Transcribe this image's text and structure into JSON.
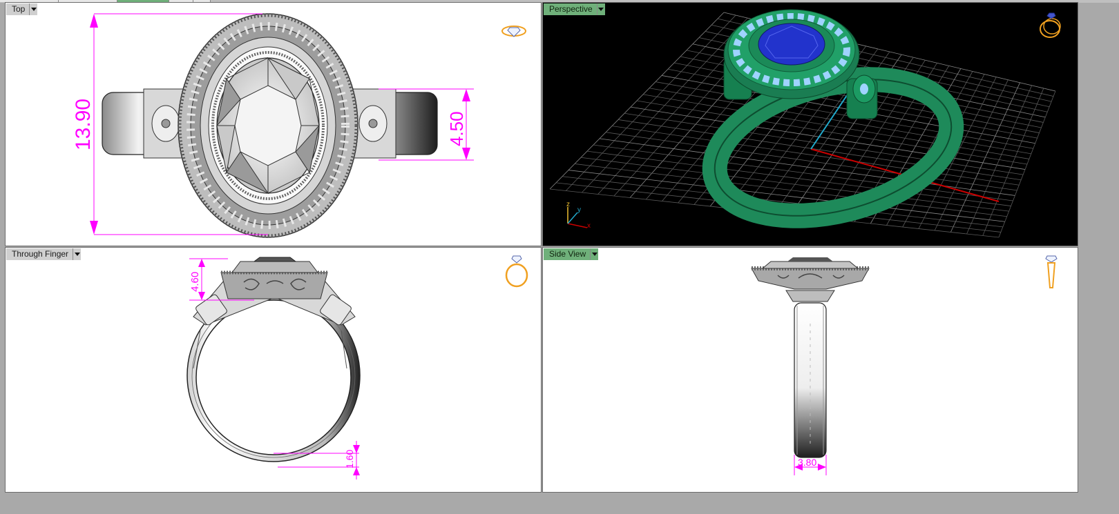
{
  "viewports": {
    "top": {
      "name": "Top",
      "dims": {
        "height": "13.90",
        "side_width": "4.50"
      }
    },
    "perspective": {
      "name": "Perspective",
      "axis_labels": {
        "z": "z",
        "y": "y",
        "x": "x"
      }
    },
    "through_finger": {
      "name": "Through Finger",
      "dims": {
        "head_height": "4.60",
        "band_thickness": "1.60"
      }
    },
    "side": {
      "name": "Side View",
      "dims": {
        "band_width": "3.80"
      }
    }
  },
  "colors": {
    "dimension": "#ff00ff",
    "active_viewport": "#6fb07a",
    "ring_render": "#1e8a5a",
    "center_stone": "#2233cc",
    "accent_stones": "#9fd3ff",
    "x_axis": "#cc0000",
    "y_axis": "#22aacc",
    "nav_icon": "#f0a020"
  },
  "icons": {
    "top": "diamond-ring-icon",
    "perspective": "ring-3d-icon",
    "through_finger": "ring-front-icon",
    "side": "ring-side-icon"
  }
}
